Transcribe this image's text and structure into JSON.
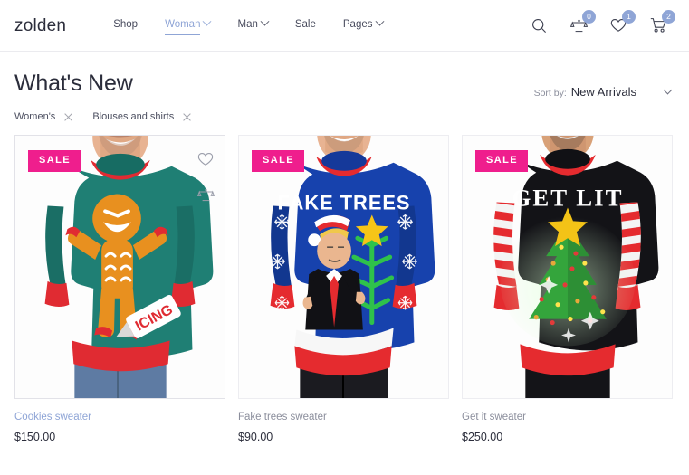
{
  "header": {
    "logo": "zolden",
    "nav": [
      {
        "label": "Shop",
        "has_caret": false,
        "active": false
      },
      {
        "label": "Woman",
        "has_caret": true,
        "active": true
      },
      {
        "label": "Man",
        "has_caret": true,
        "active": false
      },
      {
        "label": "Sale",
        "has_caret": false,
        "active": false
      },
      {
        "label": "Pages",
        "has_caret": true,
        "active": false
      }
    ],
    "actions": {
      "search_icon": "search-icon",
      "compare_icon": "compare-scales-icon",
      "compare_count": "0",
      "wishlist_icon": "heart-icon",
      "wishlist_count": "1",
      "cart_icon": "shopping-cart-icon",
      "cart_count": "2"
    }
  },
  "page": {
    "title": "What's New",
    "sort": {
      "label": "Sort by:",
      "value": "New Arrivals",
      "caret_icon": "chevron-down-icon"
    },
    "filters": [
      {
        "label": "Women's",
        "remove_icon": "close-icon"
      },
      {
        "label": "Blouses and shirts",
        "remove_icon": "close-icon"
      }
    ]
  },
  "products": [
    {
      "badge": "SALE",
      "title": "Cookies sweater",
      "price": "$150.00",
      "hovered": true,
      "wishlist_icon": "heart-icon",
      "compare_icon": "compare-scales-icon",
      "image_alt": "Man wearing teal green ugly christmas sweater with angry gingerbread man and icing tube"
    },
    {
      "badge": "SALE",
      "title": "Fake trees sweater",
      "price": "$90.00",
      "hovered": false,
      "image_alt": "Man wearing blue ugly christmas sweater reading FAKE TREES with snowflakes and cartoon figure"
    },
    {
      "badge": "SALE",
      "title": "Get it sweater",
      "price": "$250.00",
      "hovered": false,
      "image_alt": "Man wearing black ugly christmas sweater reading GET LIT with lit christmas tree and striped sleeves"
    }
  ],
  "colors": {
    "accent_blue": "#8fa5d6",
    "sale_pink": "#ef1e8d",
    "text_dark": "#2b2d3b",
    "text_muted": "#8b8e9c"
  }
}
